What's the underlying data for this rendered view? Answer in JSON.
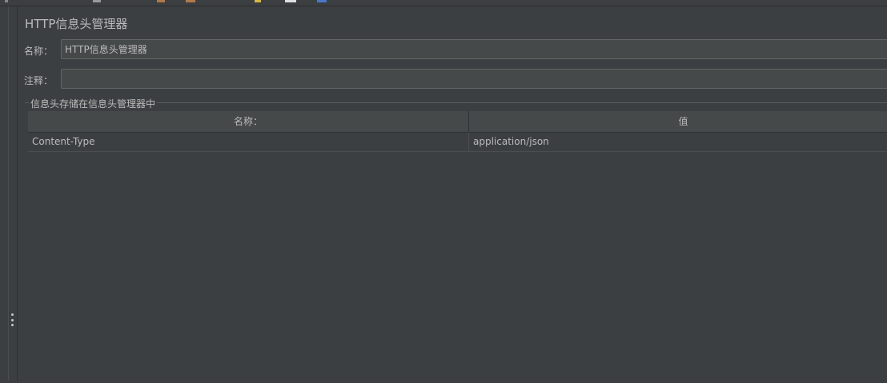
{
  "panel": {
    "title": "HTTP信息头管理器"
  },
  "form": {
    "name_label": "名称：",
    "name_value": "HTTP信息头管理器",
    "comment_label": "注释：",
    "comment_value": ""
  },
  "headers_group": {
    "title": "信息头存储在信息头管理器中",
    "columns": [
      "名称：",
      "值"
    ],
    "rows": [
      {
        "name": "Content-Type",
        "value": "application/json"
      }
    ]
  },
  "colors": {
    "background": "#3c3f41",
    "field_background": "#45494a",
    "text": "#bbbbbb"
  },
  "icons": {
    "splitter": "vertical-dots-icon"
  }
}
